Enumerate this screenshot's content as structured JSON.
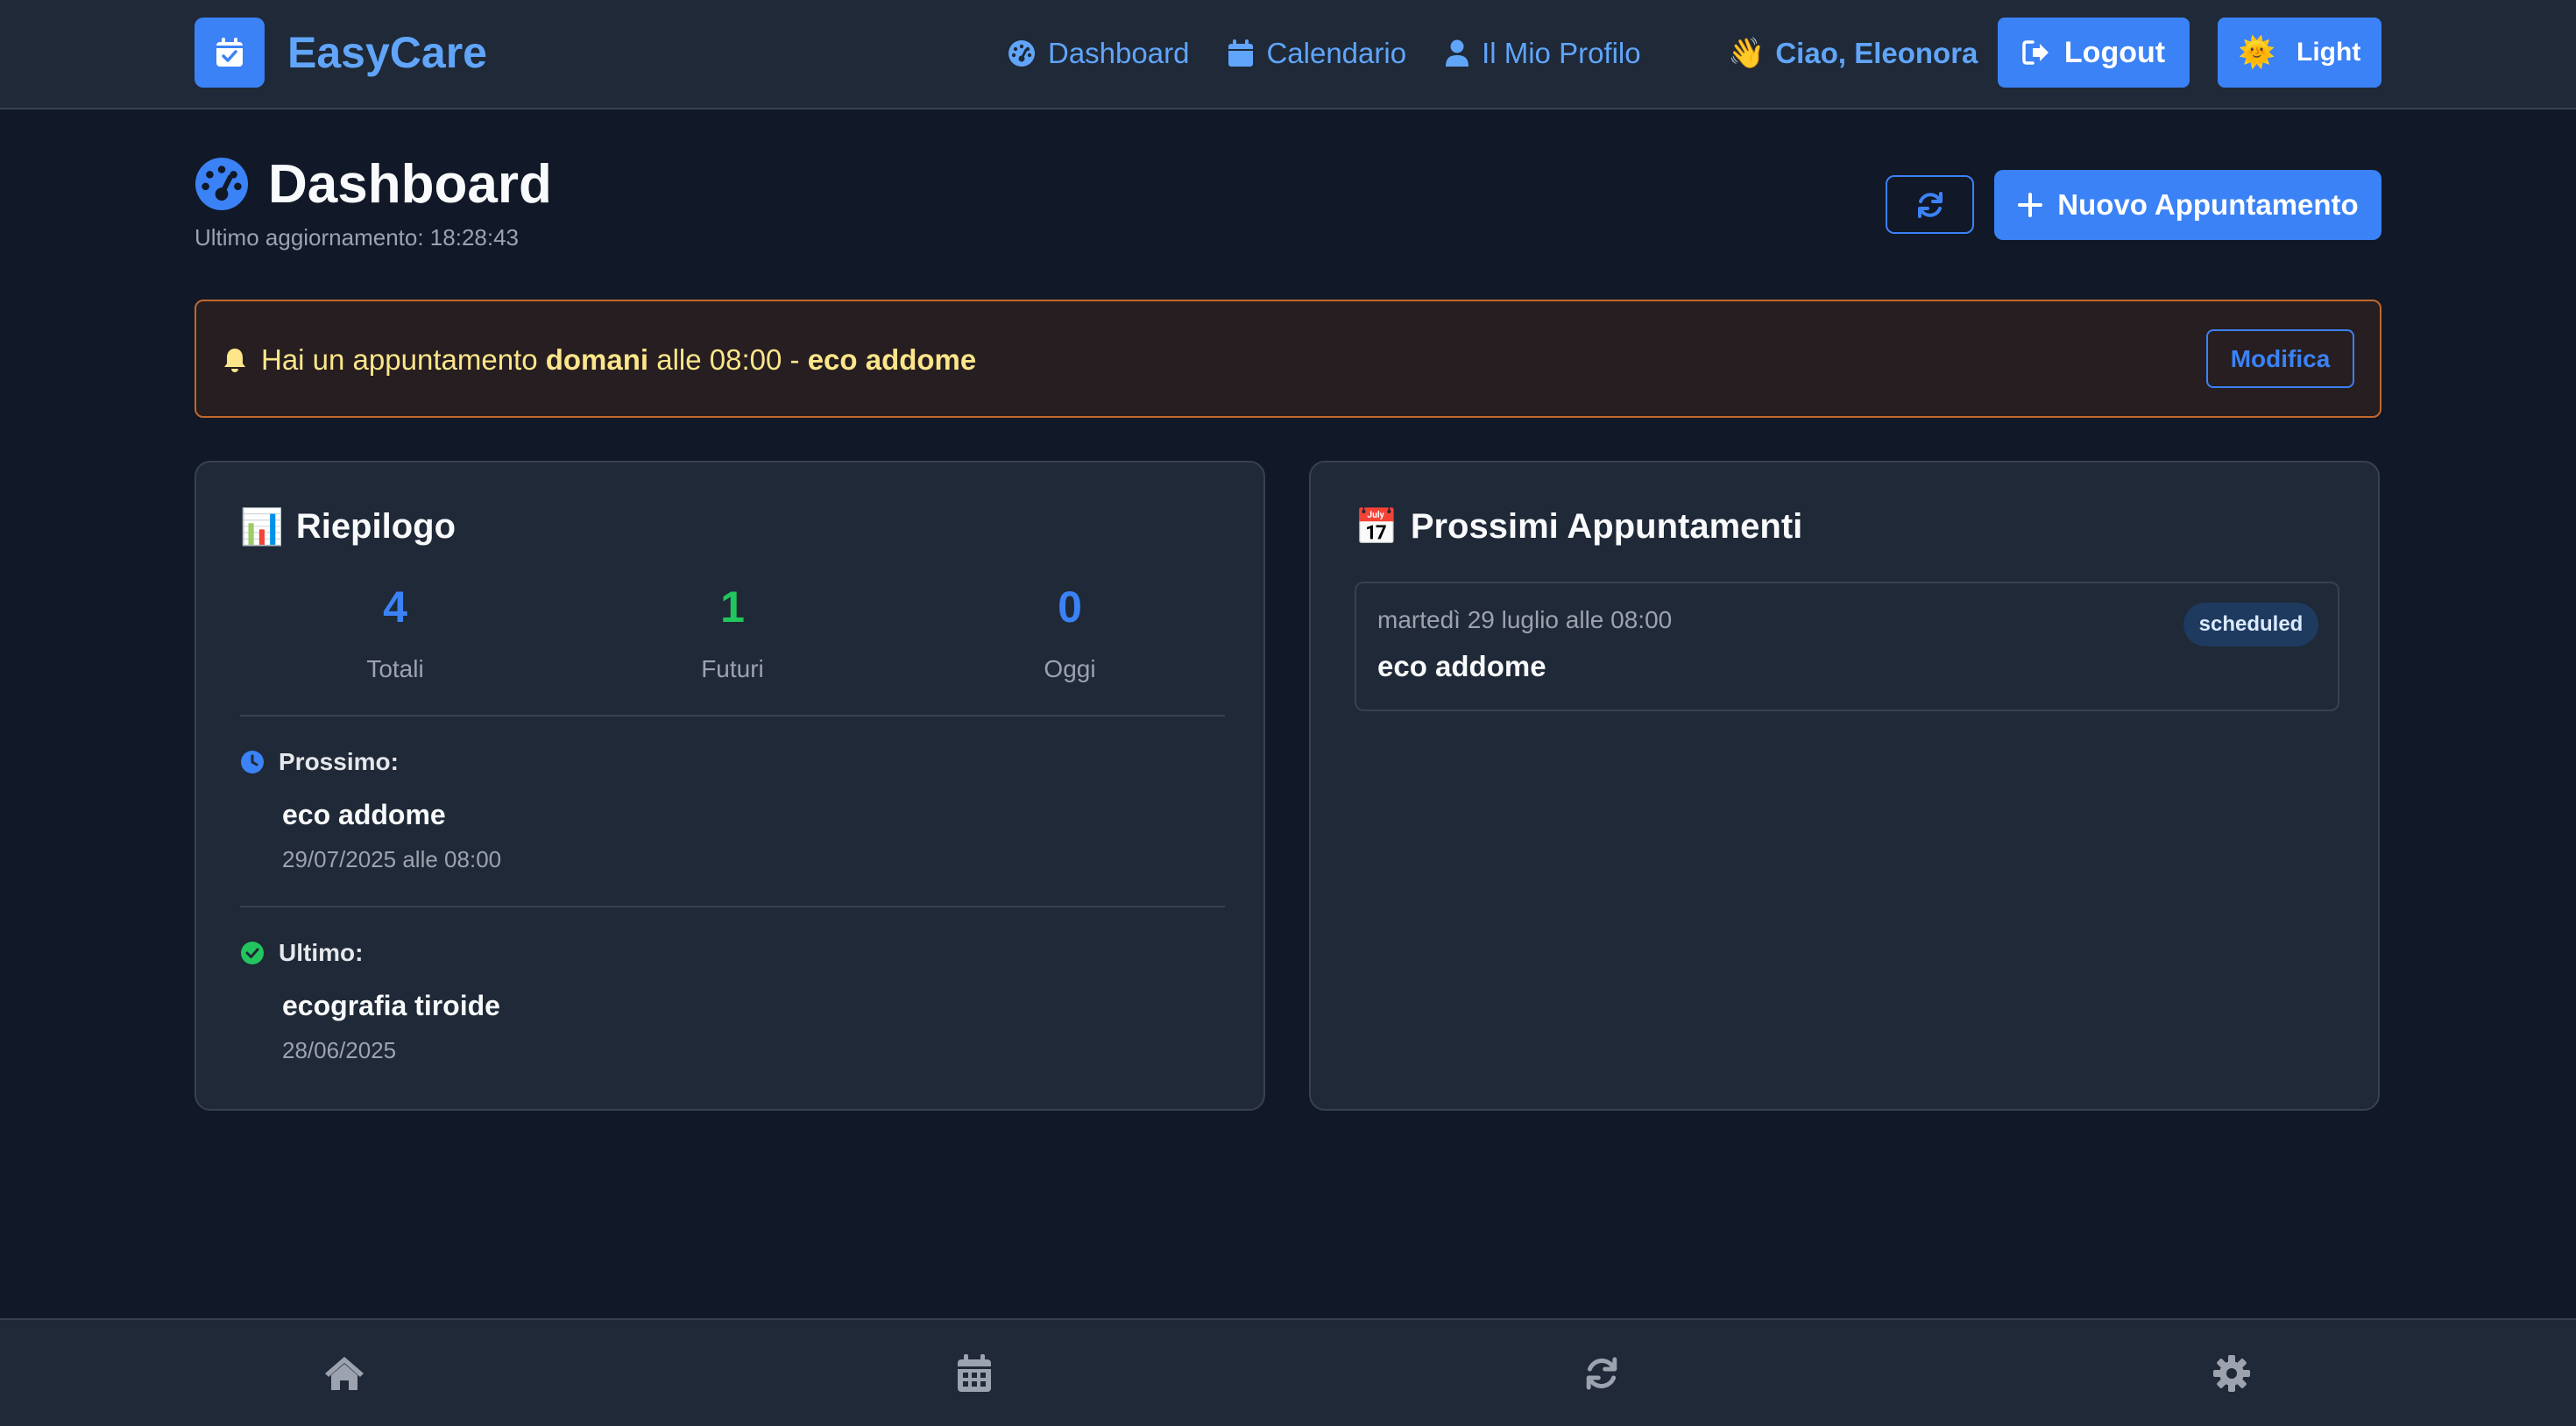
{
  "brand": {
    "name": "EasyCare",
    "icon": "calendar-check-icon"
  },
  "nav": {
    "links": [
      {
        "label": "Dashboard",
        "icon": "gauge-icon"
      },
      {
        "label": "Calendario",
        "icon": "calendar-icon"
      },
      {
        "label": "Il Mio Profilo",
        "icon": "user-icon"
      }
    ],
    "greeting_emoji": "👋",
    "greeting": "Ciao, Eleonora",
    "logout_label": "Logout",
    "theme_emoji": "🌞",
    "theme_label": "Light"
  },
  "header": {
    "title": "Dashboard",
    "last_update": "Ultimo aggiornamento: 18:28:43",
    "new_button_label": "Nuovo Appuntamento"
  },
  "alert": {
    "text_before": "Hai un appuntamento ",
    "when": "domani",
    "text_middle": " alle 08:00 - ",
    "what": "eco addome",
    "button_label": "Modifica"
  },
  "summary": {
    "emoji": "📊",
    "title": "Riepilogo",
    "stats": [
      {
        "value": "4",
        "label": "Totali"
      },
      {
        "value": "1",
        "label": "Futuri"
      },
      {
        "value": "0",
        "label": "Oggi"
      }
    ],
    "next": {
      "heading": "Prossimo:",
      "title": "eco addome",
      "date": "29/07/2025 alle 08:00"
    },
    "last": {
      "heading": "Ultimo:",
      "title": "ecografia tiroide",
      "date": "28/06/2025"
    }
  },
  "upcoming": {
    "emoji": "📅",
    "title": "Prossimi Appuntamenti",
    "items": [
      {
        "date": "martedì 29 luglio alle 08:00",
        "title": "eco addome",
        "status": "scheduled"
      }
    ]
  },
  "bottom_nav": [
    "home-icon",
    "calendar-icon",
    "refresh-icon",
    "gear-icon"
  ],
  "colors": {
    "accent": "#3b82f6",
    "background": "#111827",
    "surface": "#1f2937",
    "success": "#22c55e",
    "alert_border": "#c2682e"
  }
}
